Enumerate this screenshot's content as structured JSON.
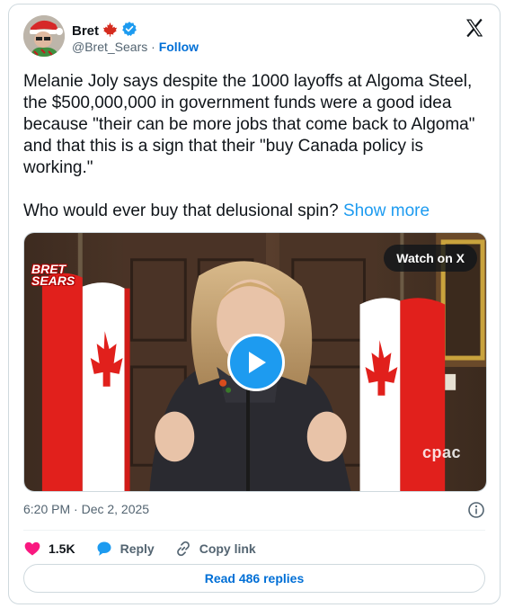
{
  "author": {
    "name": "Bret",
    "handle": "@Bret_Sears",
    "separator": "·",
    "follow_label": "Follow",
    "verified": true
  },
  "tweet": {
    "paragraph1": "Melanie Joly says despite the 1000 layoffs at Algoma Steel, the $500,000,000 in government funds were a good idea because \"their can be more jobs that come back to Algoma\" and that this is a sign that their \"buy Canada policy is working.\"",
    "paragraph2": "Who would ever buy that delusional spin?",
    "show_more_label": "Show more"
  },
  "media": {
    "watch_label": "Watch on X",
    "brand_watermark_line1": "BRET",
    "brand_watermark_line2": "SEARS",
    "broadcaster_watermark": "cpac"
  },
  "meta": {
    "timestamp": "6:20 PM · Dec 2, 2025"
  },
  "actions": {
    "like_count": "1.5K",
    "reply_label": "Reply",
    "copy_label": "Copy link"
  },
  "footer": {
    "read_replies_label": "Read 486 replies"
  },
  "colors": {
    "link": "#006fd6",
    "show_more": "#1d9bf0",
    "like": "#f91880",
    "reply": "#1d9bf0",
    "play": "#1d9bf0"
  }
}
